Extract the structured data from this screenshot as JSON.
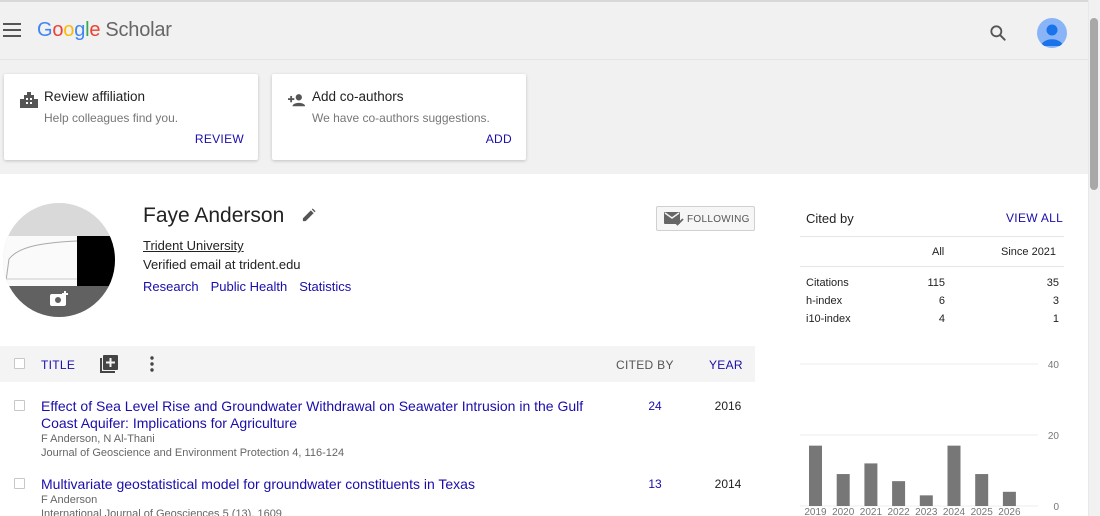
{
  "app": {
    "logo_google": [
      "G",
      "o",
      "o",
      "g",
      "l",
      "e"
    ],
    "logo_product": "Scholar"
  },
  "cards": [
    {
      "title": "Review affiliation",
      "description": "Help colleagues find you.",
      "action": "REVIEW",
      "icon": "building-icon"
    },
    {
      "title": "Add co-authors",
      "description": "We have co-authors suggestions.",
      "action": "ADD",
      "icon": "person-add-icon"
    }
  ],
  "profile": {
    "name": "Faye Anderson",
    "affiliation": "Trident University",
    "verified_email": "Verified email at trident.edu",
    "interests": [
      "Research",
      "Public Health",
      "Statistics"
    ],
    "follow_label": "FOLLOWING"
  },
  "table": {
    "headers": {
      "title": "TITLE",
      "cited_by": "CITED BY",
      "year": "YEAR"
    },
    "rows": [
      {
        "title": "Effect of Sea Level Rise and Groundwater Withdrawal on Seawater Intrusion in the Gulf Coast Aquifer: Implications for Agriculture",
        "authors": "F Anderson, N Al-Thani",
        "venue": "Journal of Geoscience and Environment Protection 4, 116-124",
        "cited_by": "24",
        "year": "2016"
      },
      {
        "title": "Multivariate geostatistical model for groundwater constituents in Texas",
        "authors": "F Anderson",
        "venue": "International Journal of Geosciences 5 (13), 1609",
        "cited_by": "13",
        "year": "2014"
      }
    ]
  },
  "cited_by": {
    "title": "Cited by",
    "view_all": "VIEW ALL",
    "columns": [
      "All",
      "Since 2021"
    ],
    "stats": [
      {
        "label": "Citations",
        "all": "115",
        "since": "35"
      },
      {
        "label": "h-index",
        "all": "6",
        "since": "3"
      },
      {
        "label": "i10-index",
        "all": "4",
        "since": "1"
      }
    ]
  },
  "chart_data": {
    "type": "bar",
    "categories": [
      "2019",
      "2020",
      "2021",
      "2022",
      "2023",
      "2024",
      "2025",
      "2026"
    ],
    "values": [
      17,
      9,
      12,
      7,
      3,
      17,
      9,
      4
    ],
    "ylim": [
      0,
      40
    ],
    "y_ticks": [
      "40",
      "20",
      "0"
    ],
    "grid": true,
    "bar_color": "#777777",
    "title": "",
    "xlabel": "",
    "ylabel": ""
  },
  "colors": {
    "link": "#1a0dab",
    "header_bg": "#f1f1f1",
    "avatar": "#8ab4f8"
  }
}
